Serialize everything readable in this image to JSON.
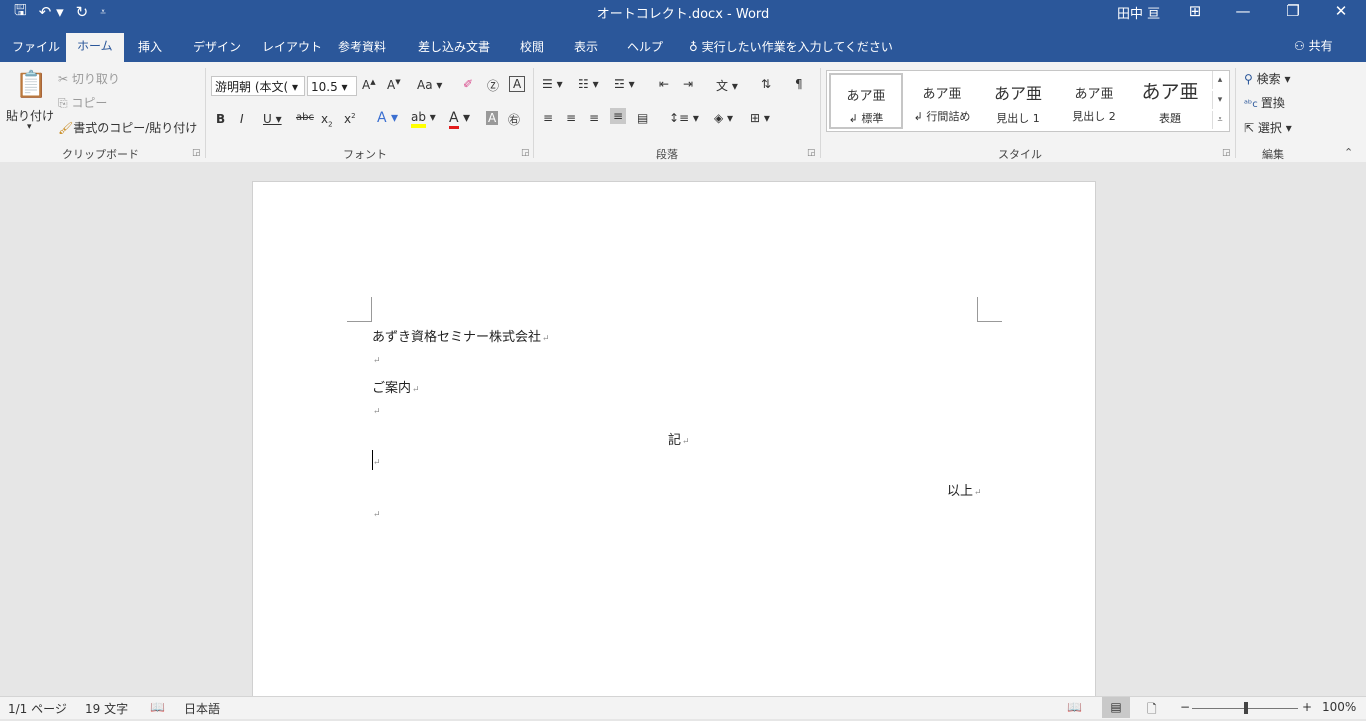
{
  "titlebar": {
    "qat": [
      "save-icon",
      "undo-icon",
      "redo-icon",
      "customize-icon"
    ],
    "doc_title": "オートコレクト.docx - Word",
    "user": "田中 亘"
  },
  "tabs": [
    "ファイル",
    "ホーム",
    "挿入",
    "デザイン",
    "レイアウト",
    "参考資料",
    "差し込み文書",
    "校閲",
    "表示",
    "ヘルプ"
  ],
  "active_tab": "ホーム",
  "tell_me": "実行したい作業を入力してください",
  "share": "共有",
  "clipboard": {
    "paste": "貼り付け",
    "cut": "切り取り",
    "copy": "コピー",
    "format_painter": "書式のコピー/貼り付け",
    "label": "クリップボード"
  },
  "font": {
    "name": "游明朝 (本文(",
    "size": "10.5",
    "case_label": "Aa",
    "label": "フォント",
    "color_font": "#e21b1b",
    "color_highlight": "#ffff00"
  },
  "paragraph": {
    "label": "段落"
  },
  "styles": {
    "items": [
      {
        "sample": "あア亜",
        "name": "↲ 標準"
      },
      {
        "sample": "あア亜",
        "name": "↲ 行間詰め"
      },
      {
        "sample": "あア亜",
        "name": "見出し 1"
      },
      {
        "sample": "あア亜",
        "name": "見出し 2"
      },
      {
        "sample": "あア亜",
        "name": "表題"
      }
    ],
    "label": "スタイル"
  },
  "editing": {
    "find": "検索",
    "replace": "置換",
    "select": "選択",
    "label": "編集"
  },
  "document": {
    "lines": [
      "あずき資格セミナー株式会社",
      "",
      "ご案内",
      "",
      "記",
      "",
      "以上",
      ""
    ],
    "paragraph_mark": "↵"
  },
  "status": {
    "page": "1/1 ページ",
    "words": "19 文字",
    "language": "日本語",
    "zoom": "100%"
  },
  "colors": {
    "accent": "#2b579a"
  }
}
